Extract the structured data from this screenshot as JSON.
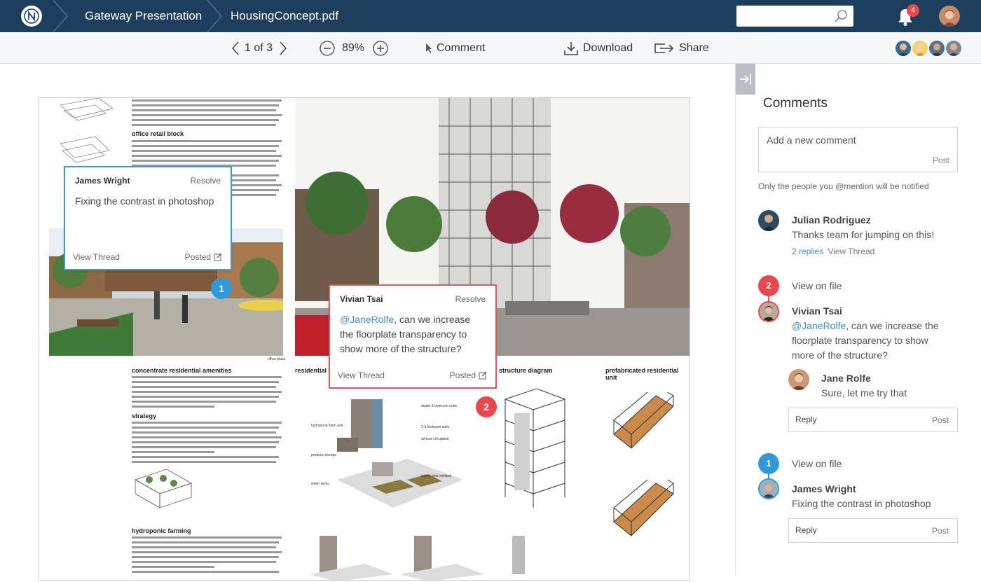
{
  "colors": {
    "topbar": "#1c3f5e",
    "accent_blue": "#2f9ad9",
    "accent_red": "#e8474c",
    "link": "#3b8ed6"
  },
  "topbar": {
    "logo_icon": "n-logo-icon",
    "breadcrumbs": [
      "Gateway Presentation",
      "HousingConcept.pdf"
    ],
    "search_placeholder": "",
    "notification_count": "4"
  },
  "toolbar": {
    "page_indicator": "1 of 3",
    "zoom": "89%",
    "comment_label": "Comment",
    "download_label": "Download",
    "share_label": "Share"
  },
  "document": {
    "sections": [
      "office retail block",
      "concentrate residential amenities",
      "strategy",
      "hydroponic farming",
      "residential tow",
      "structure diagram",
      "prefabricated residential unit"
    ],
    "photo_caption": "office plaza",
    "diagram_labels": [
      "studio-1 bedroom units",
      "2-3 bedroom units",
      "vertical circulation",
      "hydroponic farm unit",
      "produce storage",
      "indoor tidal wetland",
      "water tanks"
    ]
  },
  "annotations": [
    {
      "name": "James Wright",
      "resolve": "Resolve",
      "text": "Fixing the contrast in photoshop",
      "view": "View Thread",
      "posted": "Posted",
      "pin": "1"
    },
    {
      "name": "Vivian Tsai",
      "resolve": "Resolve",
      "mention": "@JaneRolfe",
      "text": ", can we increase the floorplate transparency to show more of the structure?",
      "view": "View Thread",
      "posted": "Posted",
      "pin": "2"
    }
  ],
  "sidebar": {
    "title": "Comments",
    "new_comment_placeholder": "Add a new comment",
    "post_label": "Post",
    "hint": "Only the people you @mention will be notified",
    "comments": [
      {
        "name": "Julian Rodriguez",
        "text": "Thanks team for jumping on this!",
        "replies": "2 replies",
        "view": "View Thread"
      }
    ],
    "threads": [
      {
        "pin": "2",
        "view_on_file": "View on file",
        "name": "Vivian Tsai",
        "mention": "@JaneRolfe",
        "text": ", can we increase the floorplate transparency to show more of the structure?",
        "reply_name": "Jane Rolfe",
        "reply_text": "Sure, let me try that",
        "reply_placeholder": "Reply",
        "post": "Post"
      },
      {
        "pin": "1",
        "view_on_file": "View on file",
        "name": "James Wright",
        "text": "Fixing the contrast in photoshop",
        "reply_placeholder": "Reply",
        "post": "Post"
      }
    ]
  }
}
